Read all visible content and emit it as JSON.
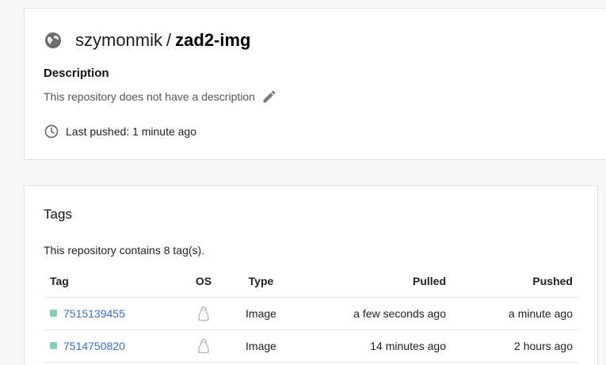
{
  "repo": {
    "owner": "szymonmik",
    "separator": "/",
    "name": "zad2-img",
    "description_heading": "Description",
    "description_text": "This repository does not have a description",
    "last_pushed": "Last pushed: 1 minute ago"
  },
  "tags": {
    "heading": "Tags",
    "count_text": "This repository contains 8 tag(s).",
    "columns": {
      "tag": "Tag",
      "os": "OS",
      "type": "Type",
      "pulled": "Pulled",
      "pushed": "Pushed"
    },
    "rows": [
      {
        "tag": "7515139455",
        "os_icon": "linux-icon",
        "type": "Image",
        "pulled": "a few seconds ago",
        "pushed": "a minute ago"
      },
      {
        "tag": "7514750820",
        "os_icon": "linux-icon",
        "type": "Image",
        "pulled": "14 minutes ago",
        "pushed": "2 hours ago"
      }
    ]
  },
  "colors": {
    "link": "#3a6fd8",
    "status_dot": "#7fd3b5",
    "icon_gray": "#7a7a7a"
  }
}
